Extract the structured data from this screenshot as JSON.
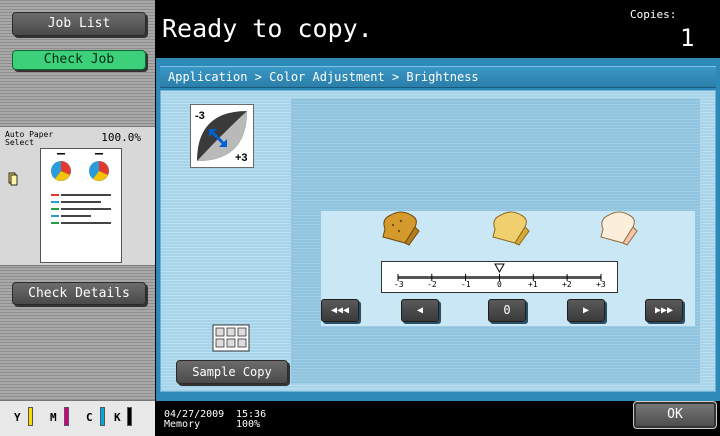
{
  "left_pane": {
    "job_list_label": "Job List",
    "check_job_label": "Check Job",
    "paper_select_label": "Auto Paper\nSelect",
    "zoom_label": "100.0%",
    "check_details_label": "Check Details",
    "toner": [
      {
        "letter": "Y",
        "color": "#f6dc00"
      },
      {
        "letter": "M",
        "color": "#d5008a"
      },
      {
        "letter": "C",
        "color": "#00a8e0"
      },
      {
        "letter": "K",
        "color": "#000000"
      }
    ]
  },
  "header": {
    "title": "Ready to copy.",
    "copies_label": "Copies:",
    "copies_value": "1"
  },
  "main": {
    "breadcrumb": "Application > Color Adjustment > Brightness",
    "scale_ticks": [
      "-3",
      "-2",
      "-1",
      "0",
      "+1",
      "+2",
      "+3"
    ],
    "current_value_index": 3,
    "buttons": {
      "far_left": "◀◀◀",
      "left": "◀",
      "center": "0",
      "right": "▶",
      "far_right": "▶▶▶"
    },
    "icon_minus": "-3",
    "icon_plus": "+3",
    "sample_copy_label": "Sample Copy"
  },
  "footer": {
    "date": "04/27/2009",
    "memory_label": "Memory",
    "time": "15:36",
    "memory_value": "100%",
    "ok_label": "OK"
  },
  "colors": {
    "accent_blue": "#2d89b7",
    "check_job_green": "#3dd07a"
  }
}
